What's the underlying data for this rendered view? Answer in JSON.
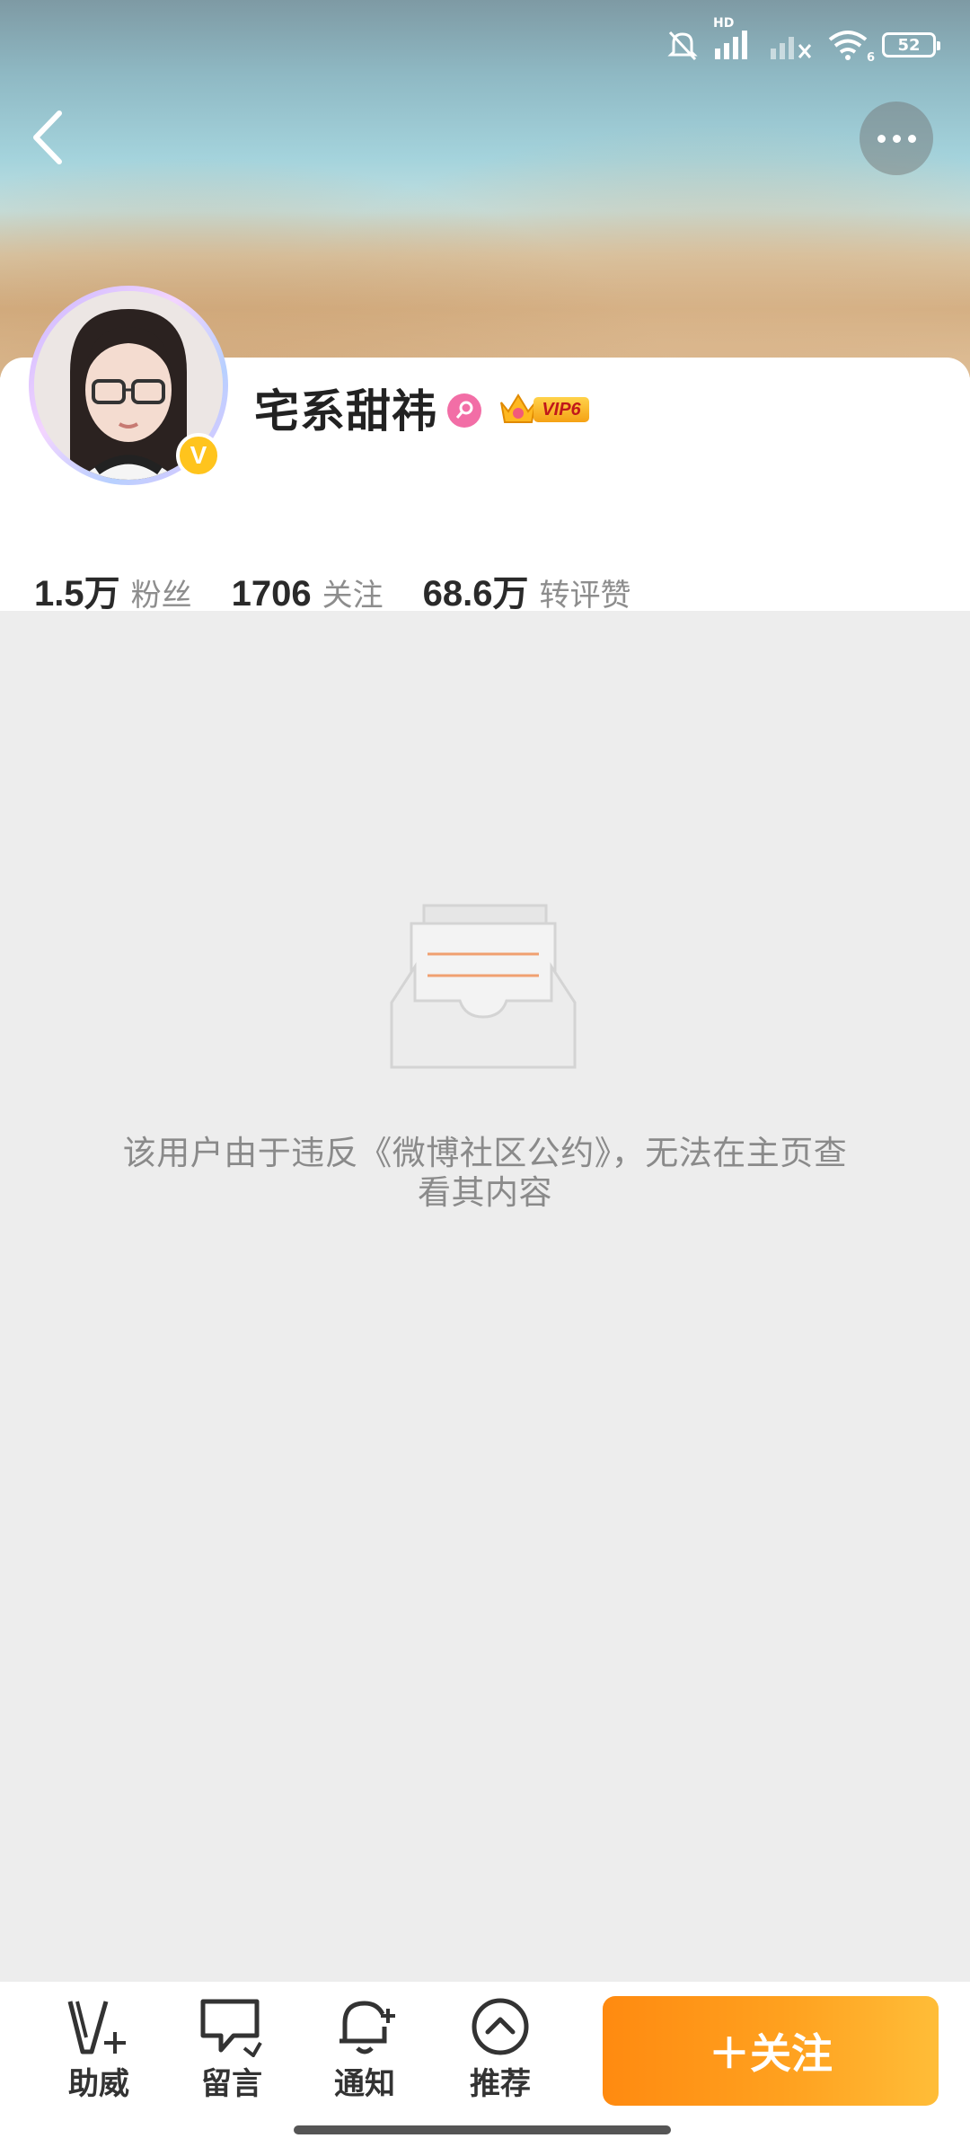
{
  "status_bar": {
    "network": "HD",
    "wifi_sub": "6",
    "battery": "52"
  },
  "header": {
    "back_icon": "chevron-left-icon",
    "more_icon": "more-dots-icon"
  },
  "profile": {
    "name": "宅系甜祎",
    "verified_badge": "V",
    "gender_icon": "female-icon",
    "vip_label": "VIP6"
  },
  "stats": [
    {
      "value": "1.5",
      "unit": "万",
      "label": "粉丝"
    },
    {
      "value": "1706",
      "unit": "",
      "label": "关注"
    },
    {
      "value": "68.6",
      "unit": "万",
      "label": "转评赞"
    }
  ],
  "empty_state": {
    "icon": "empty-inbox-icon",
    "line1": "该用户由于违反《微博社区公约》，无法在主页查",
    "line2": "看其内容"
  },
  "bottom_bar": {
    "tabs": [
      {
        "label": "助威",
        "icon": "cheer-icon"
      },
      {
        "label": "留言",
        "icon": "message-icon"
      },
      {
        "label": "通知",
        "icon": "bell-plus-icon"
      },
      {
        "label": "推荐",
        "icon": "recommend-up-icon"
      }
    ],
    "follow_label": "＋关注"
  },
  "colors": {
    "accent": "#ff8d14",
    "verified": "#ffc41d",
    "gender": "#f26ea6"
  }
}
